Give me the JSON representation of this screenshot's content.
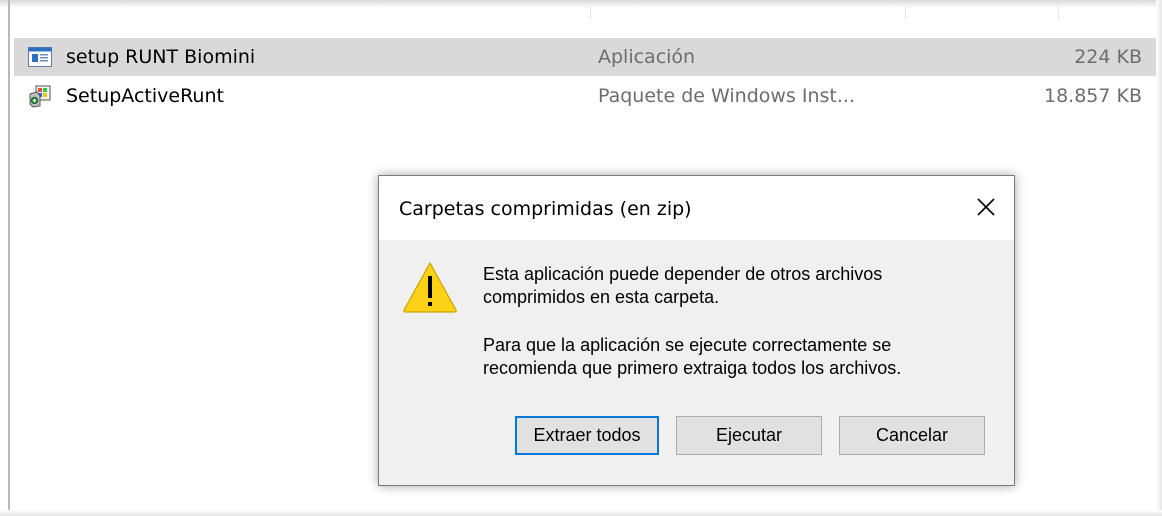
{
  "files": [
    {
      "name": "setup RUNT Biomini",
      "type": "Aplicación",
      "size": "224 KB",
      "icon": "application-icon",
      "selected": true
    },
    {
      "name": "SetupActiveRunt",
      "type": "Paquete de Windows Inst...",
      "size": "18.857 KB",
      "icon": "windows-installer-icon",
      "selected": false
    }
  ],
  "dialog": {
    "title": "Carpetas comprimidas (en zip)",
    "close_icon": "close-icon",
    "warning_icon": "warning-icon",
    "message_line1": "Esta aplicación puede depender de otros archivos",
    "message_line2": "comprimidos en esta carpeta.",
    "message_line3": "Para que la aplicación se ejecute correctamente se",
    "message_line4": "recomienda que primero extraiga todos los archivos.",
    "buttons": {
      "extract_all": "Extraer todos",
      "run": "Ejecutar",
      "cancel": "Cancelar"
    }
  },
  "colors": {
    "selection": "#d9d9d9",
    "dialog_bg": "#f0f0f0",
    "default_button_border": "#0078d7",
    "warning_yellow": "#fcd116",
    "secondary_text": "#6d6d6d"
  }
}
